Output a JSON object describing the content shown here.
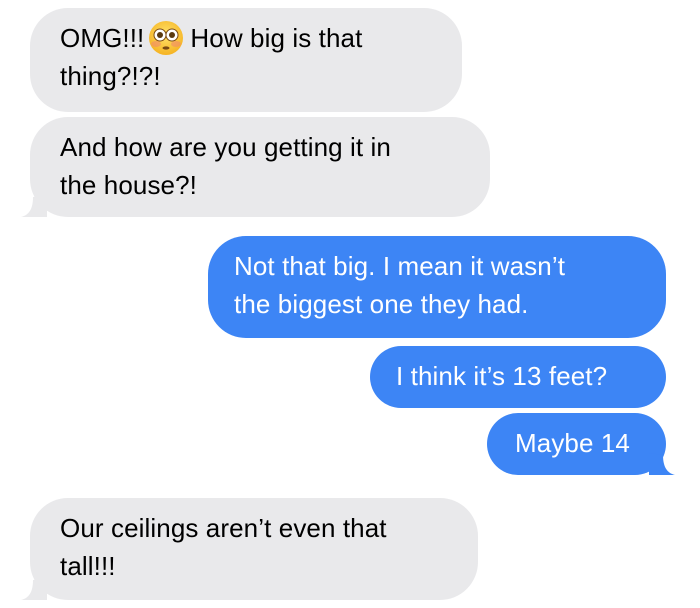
{
  "messages": [
    {
      "direction": "received",
      "lines": [
        "OMG!!!",
        "How big is that",
        "thing?!?!"
      ],
      "emoji": "flushed-face-icon"
    },
    {
      "direction": "received",
      "lines": [
        "And how are you getting it in",
        "the house?!"
      ]
    },
    {
      "direction": "sent",
      "lines": [
        "Not that big. I mean it wasn’t",
        "the biggest one they had."
      ]
    },
    {
      "direction": "sent",
      "lines": [
        "I think it’s 13 feet?"
      ]
    },
    {
      "direction": "sent",
      "lines": [
        "Maybe 14"
      ]
    },
    {
      "direction": "received",
      "lines": [
        "Our ceilings aren’t even that",
        "tall!!!"
      ]
    }
  ],
  "colors": {
    "received_bubble": "#e9e9eb",
    "sent_bubble": "#3d85f5",
    "sent_text": "#ffffff",
    "received_text": "#000000"
  }
}
